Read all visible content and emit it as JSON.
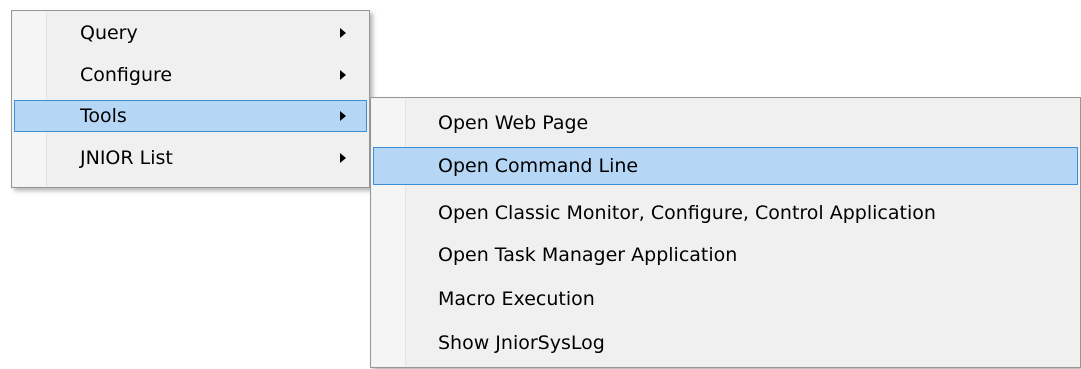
{
  "main_menu": {
    "items": [
      {
        "label": "Query"
      },
      {
        "label": "Configure"
      },
      {
        "label": "Tools"
      },
      {
        "label": "JNIOR List"
      }
    ]
  },
  "submenu": {
    "items": [
      {
        "label": "Open Web Page"
      },
      {
        "label": "Open Command Line"
      },
      {
        "label": "Open Classic Monitor, Configure, Control Application"
      },
      {
        "label": "Open Task Manager Application"
      },
      {
        "label": "Macro Execution"
      },
      {
        "label": "Show JniorSysLog"
      }
    ]
  },
  "colors": {
    "highlight_bg": "#b6d6f6",
    "highlight_border": "#3c8fd7",
    "menu_bg": "#f0f0f0"
  },
  "icons": [
    "chevron-right-icon"
  ]
}
